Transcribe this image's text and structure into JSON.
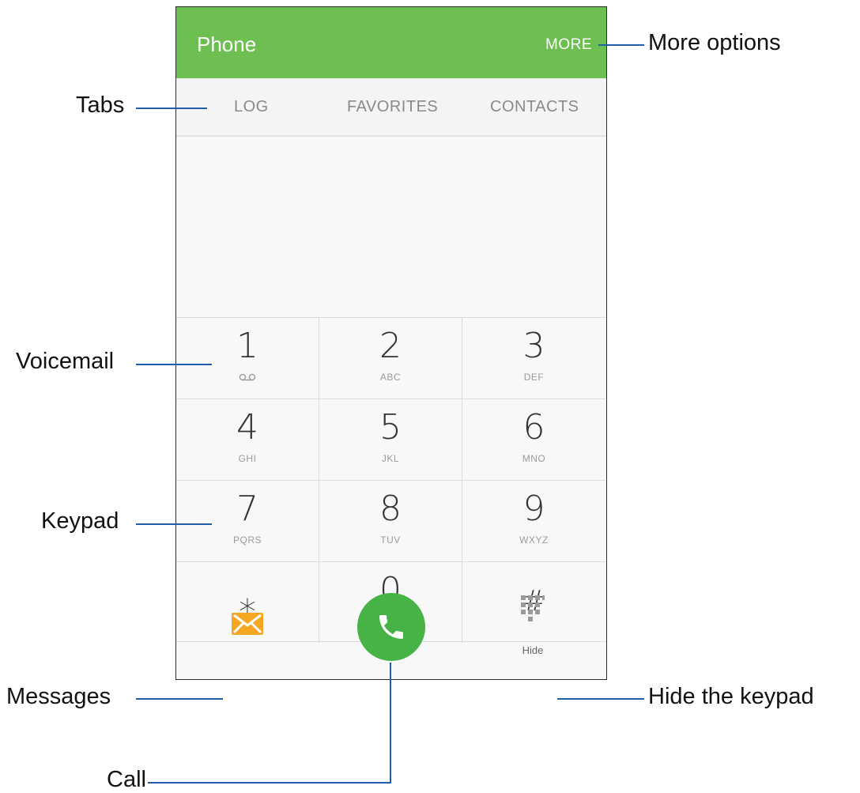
{
  "app_bar": {
    "title": "Phone",
    "more_label": "MORE",
    "color": "#6cbf50"
  },
  "tabs": [
    {
      "label": "LOG"
    },
    {
      "label": "FAVORITES"
    },
    {
      "label": "CONTACTS"
    }
  ],
  "keys": [
    {
      "digit": "1",
      "letters": ""
    },
    {
      "digit": "2",
      "letters": "ABC"
    },
    {
      "digit": "3",
      "letters": "DEF"
    },
    {
      "digit": "4",
      "letters": "GHI"
    },
    {
      "digit": "5",
      "letters": "JKL"
    },
    {
      "digit": "6",
      "letters": "MNO"
    },
    {
      "digit": "7",
      "letters": "PQRS"
    },
    {
      "digit": "8",
      "letters": "TUV"
    },
    {
      "digit": "9",
      "letters": "WXYZ"
    },
    {
      "digit": "⁎",
      "letters": ""
    },
    {
      "digit": "0",
      "letters": "+"
    },
    {
      "digit": "#",
      "letters": ""
    }
  ],
  "bottom": {
    "hide_label": "Hide",
    "message_icon": "envelope-icon",
    "call_icon": "phone-handset-icon",
    "hide_icon": "dialpad-icon",
    "call_color": "#47b347",
    "message_color": "#f5a623"
  },
  "callouts": {
    "more_options": "More options",
    "tabs": "Tabs",
    "voicemail": "Voicemail",
    "keypad": "Keypad",
    "messages": "Messages",
    "call": "Call",
    "hide_keypad": "Hide the keypad"
  }
}
